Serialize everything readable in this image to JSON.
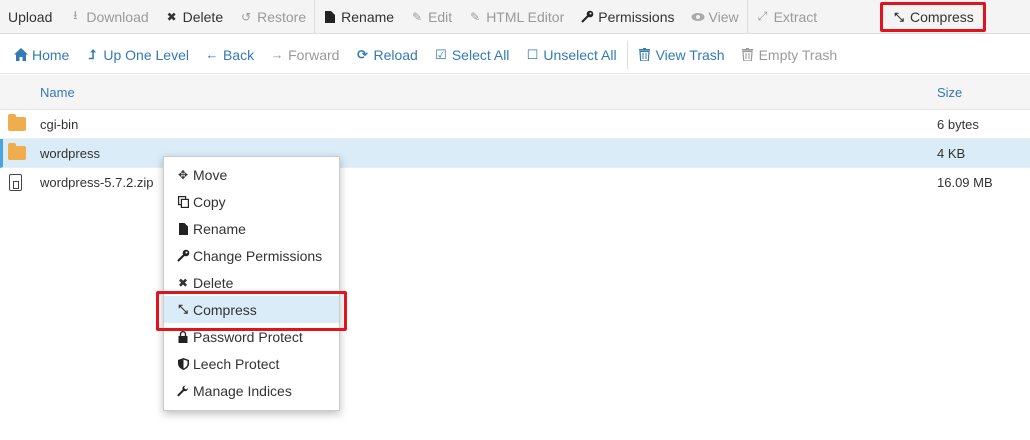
{
  "toolbar": {
    "items": [
      {
        "label": "Upload",
        "icon": "upload-icon",
        "disabled": false
      },
      {
        "label": "Download",
        "icon": "download-icon",
        "disabled": true
      },
      {
        "label": "Delete",
        "icon": "close-icon",
        "disabled": false
      },
      {
        "label": "Restore",
        "icon": "restore-icon",
        "disabled": true
      },
      {
        "label": "Rename",
        "icon": "file-icon",
        "disabled": false
      },
      {
        "label": "Edit",
        "icon": "pencil-icon",
        "disabled": true
      },
      {
        "label": "HTML Editor",
        "icon": "edit-icon",
        "disabled": true
      },
      {
        "label": "Permissions",
        "icon": "key-icon",
        "disabled": false
      },
      {
        "label": "View",
        "icon": "eye-icon",
        "disabled": true
      },
      {
        "label": "Extract",
        "icon": "expand-icon",
        "disabled": true
      },
      {
        "label": "Compress",
        "icon": "compress-icon",
        "disabled": false
      }
    ]
  },
  "nav": {
    "items": [
      {
        "label": "Home",
        "icon": "home-icon",
        "disabled": false
      },
      {
        "label": "Up One Level",
        "icon": "level-up-icon",
        "disabled": false
      },
      {
        "label": "Back",
        "icon": "arrow-left-icon",
        "disabled": false
      },
      {
        "label": "Forward",
        "icon": "arrow-right-icon",
        "disabled": true
      },
      {
        "label": "Reload",
        "icon": "refresh-icon",
        "disabled": false
      },
      {
        "label": "Select All",
        "icon": "checkbox-checked-icon",
        "disabled": false
      },
      {
        "label": "Unselect All",
        "icon": "checkbox-empty-icon",
        "disabled": false
      },
      {
        "label": "View Trash",
        "icon": "trash-icon",
        "disabled": false
      },
      {
        "label": "Empty Trash",
        "icon": "trash-icon",
        "disabled": true
      }
    ]
  },
  "table": {
    "headers": {
      "name": "Name",
      "size": "Size"
    },
    "rows": [
      {
        "name": "cgi-bin",
        "size": "6 bytes",
        "type": "folder"
      },
      {
        "name": "wordpress",
        "size": "4 KB",
        "type": "folder",
        "selected": true
      },
      {
        "name": "wordpress-5.7.2.zip",
        "size": "16.09 MB",
        "type": "zip"
      }
    ]
  },
  "context_menu": {
    "items": [
      {
        "label": "Move",
        "icon": "move-icon"
      },
      {
        "label": "Copy",
        "icon": "copy-icon"
      },
      {
        "label": "Rename",
        "icon": "file-icon"
      },
      {
        "label": "Change Permissions",
        "icon": "key-icon"
      },
      {
        "label": "Delete",
        "icon": "close-icon"
      },
      {
        "label": "Compress",
        "icon": "compress-icon",
        "active": true
      },
      {
        "label": "Password Protect",
        "icon": "lock-icon"
      },
      {
        "label": "Leech Protect",
        "icon": "shield-icon"
      },
      {
        "label": "Manage Indices",
        "icon": "wrench-icon"
      }
    ]
  },
  "colors": {
    "link": "#337ab7",
    "highlight": "#e0141e",
    "selected_row": "#d9ecf7",
    "folder": "#f0ad4e"
  }
}
